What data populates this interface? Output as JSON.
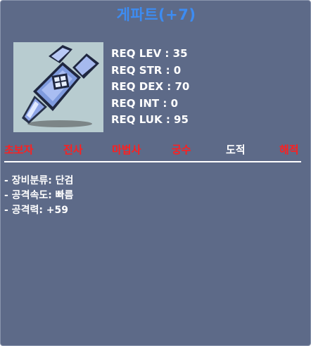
{
  "item": {
    "name": "게파트(+7)",
    "name_color": "#3d8cf2",
    "icon": "dagger-icon"
  },
  "requirements": [
    "REQ LEV : 35",
    "REQ STR : 0",
    "REQ DEX : 70",
    "REQ INT : 0",
    "REQ LUK : 95"
  ],
  "jobs": [
    {
      "label": "초보자",
      "allowed": false
    },
    {
      "label": "전사",
      "allowed": false
    },
    {
      "label": "마법사",
      "allowed": false
    },
    {
      "label": "궁수",
      "allowed": false
    },
    {
      "label": "도적",
      "allowed": true
    },
    {
      "label": "해적",
      "allowed": false
    }
  ],
  "stats": [
    "- 장비분류: 단검",
    "- 공격속도: 빠름",
    "- 공격력: +59"
  ],
  "colors": {
    "panel": "#5d6a88",
    "job_denied": "#ff1f1f",
    "job_allowed": "#ffffff"
  }
}
